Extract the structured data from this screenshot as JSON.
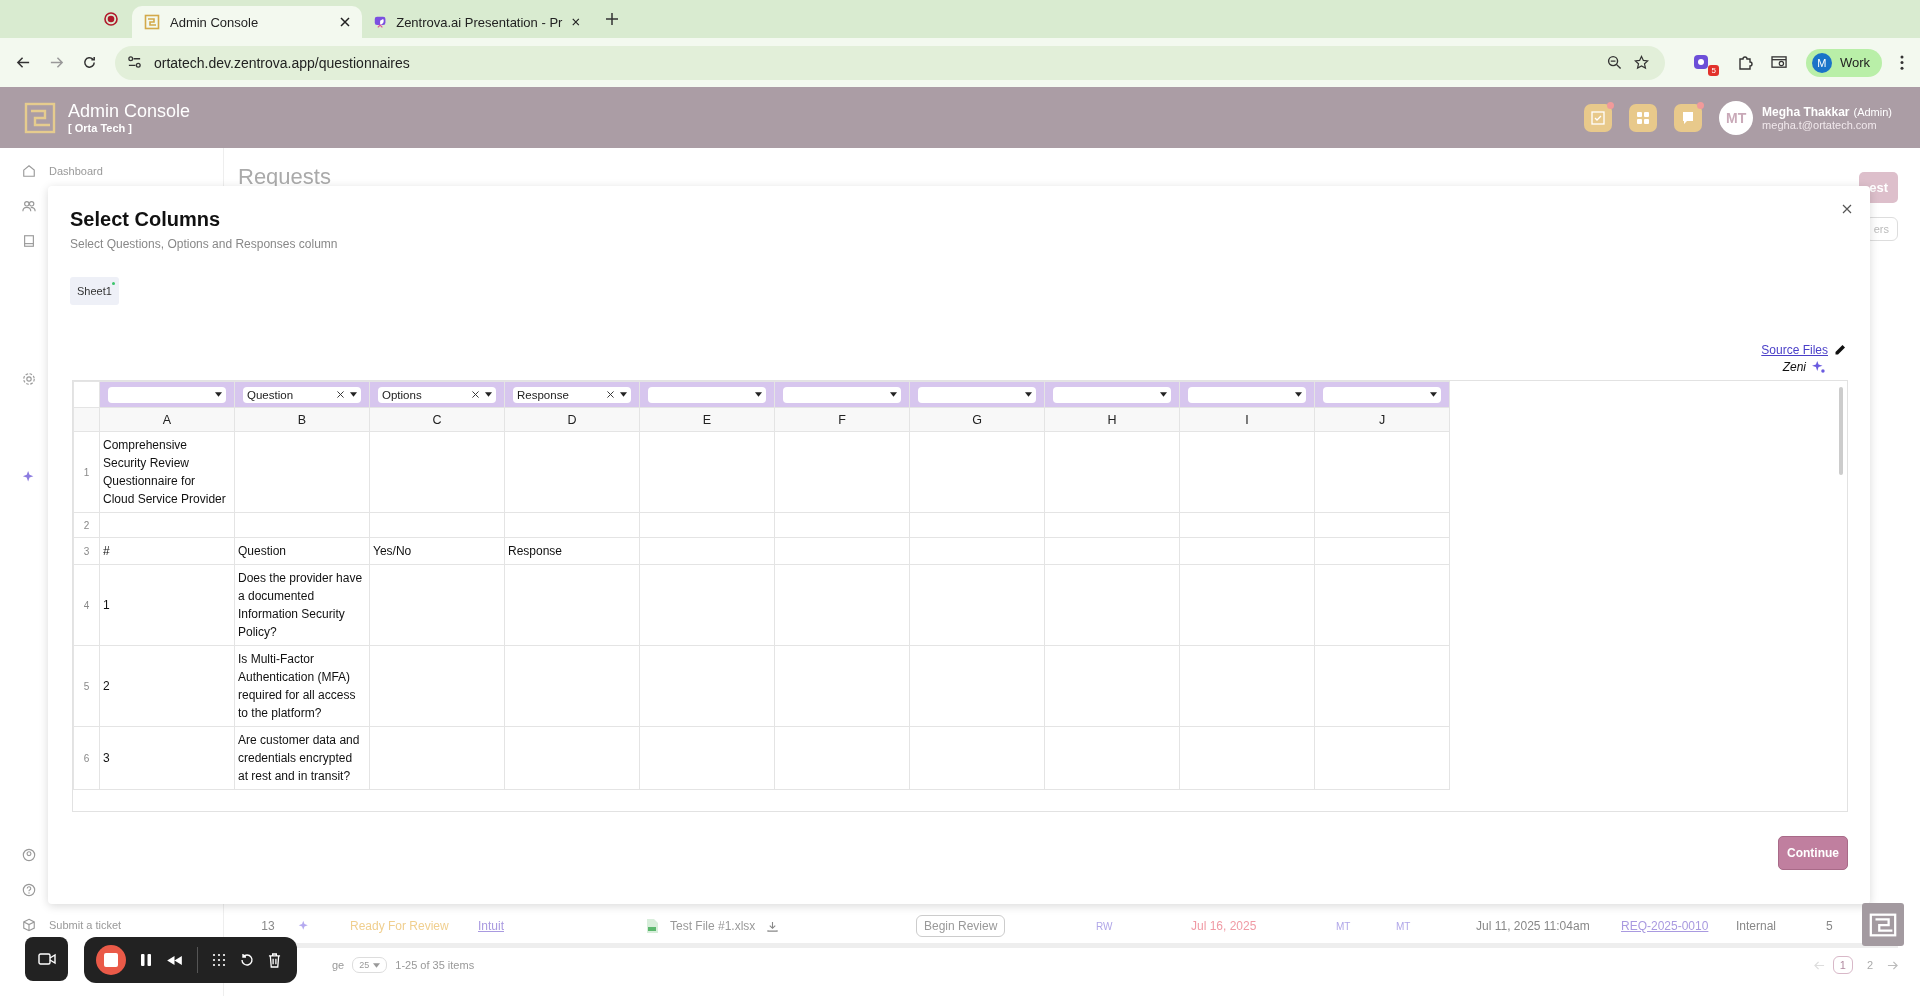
{
  "browser": {
    "tabs": [
      {
        "title": "Admin Console",
        "selected": true,
        "kind": "logo"
      },
      {
        "title": "Zentrova.ai Presentation - Pr",
        "selected": false,
        "kind": "slides"
      }
    ],
    "url": "ortatech.dev.zentrova.app/questionnaires",
    "extension_badge": "5",
    "profile": {
      "initial": "M",
      "label": "Work"
    }
  },
  "header": {
    "title": "Admin Console",
    "org": "[ Orta Tech ]",
    "actions": [
      {
        "kind": "checklist",
        "alert": true
      },
      {
        "kind": "grid",
        "alert": false
      },
      {
        "kind": "chat",
        "alert": true
      }
    ],
    "user": {
      "initials": "MT",
      "name": "Megha Thakkar",
      "role": "(Admin)",
      "email": "megha.t@ortatech.com"
    }
  },
  "sidebar": {
    "items": [
      {
        "kind": "home",
        "label": "Dashboard"
      },
      {
        "kind": "users"
      },
      {
        "kind": "book"
      },
      {
        "kind": "gear"
      },
      {
        "kind": "sparkle"
      },
      {
        "kind": "user"
      },
      {
        "kind": "help"
      },
      {
        "kind": "box",
        "label": "Submit a ticket"
      }
    ]
  },
  "page": {
    "title": "Requests",
    "primary_button": "est",
    "filter_button": "ers",
    "table_row": {
      "number": "13",
      "status": "Ready For Review",
      "company": "Intuit",
      "file": "Test File #1.xlsx",
      "action": "Begin Review",
      "assignee": "RW",
      "due": "Jul 16, 2025",
      "owner": "MT",
      "reviewer": "MT",
      "created": "Jul 11, 2025 11:04am",
      "request_id": "REQ-2025-0010",
      "type": "Internal",
      "count": "5"
    },
    "pagination": {
      "per_page_label": "ge",
      "per_page": "25",
      "summary": "1-25 of 35 items",
      "pages": [
        {
          "label": "1",
          "selected": true
        },
        {
          "label": "2",
          "selected": false
        }
      ]
    }
  },
  "modal": {
    "title": "Select Columns",
    "subtitle": "Select Questions, Options and Responses column",
    "sheets": [
      {
        "label": "Sheet1",
        "selected": true
      }
    ],
    "source_link": "Source Files",
    "assistant": "Zeni",
    "columns": [
      {
        "letter": "A"
      },
      {
        "letter": "B",
        "mapping": "Question"
      },
      {
        "letter": "C",
        "mapping": "Options"
      },
      {
        "letter": "D",
        "mapping": "Response"
      },
      {
        "letter": "E"
      },
      {
        "letter": "F"
      },
      {
        "letter": "G"
      },
      {
        "letter": "H"
      },
      {
        "letter": "I"
      },
      {
        "letter": "J"
      }
    ],
    "rows": [
      {
        "number": "1",
        "cells": {
          "A": "Comprehensive Security Review Questionnaire for Cloud Service Provider"
        }
      },
      {
        "number": "2"
      },
      {
        "number": "3",
        "cells": {
          "A": "#",
          "B": "Question",
          "C": "Yes/No",
          "D": "Response"
        }
      },
      {
        "number": "4",
        "cells": {
          "A": "1",
          "B": "Does the provider have a documented Information Security Policy?"
        }
      },
      {
        "number": "5",
        "cells": {
          "A": "2",
          "B": "Is Multi-Factor Authentication (MFA) required for all access to the platform?"
        }
      },
      {
        "number": "6",
        "cells": {
          "A": "3",
          "B": "Are customer data and credentials encrypted at rest and in transit?"
        }
      }
    ],
    "continue": "Continue"
  }
}
